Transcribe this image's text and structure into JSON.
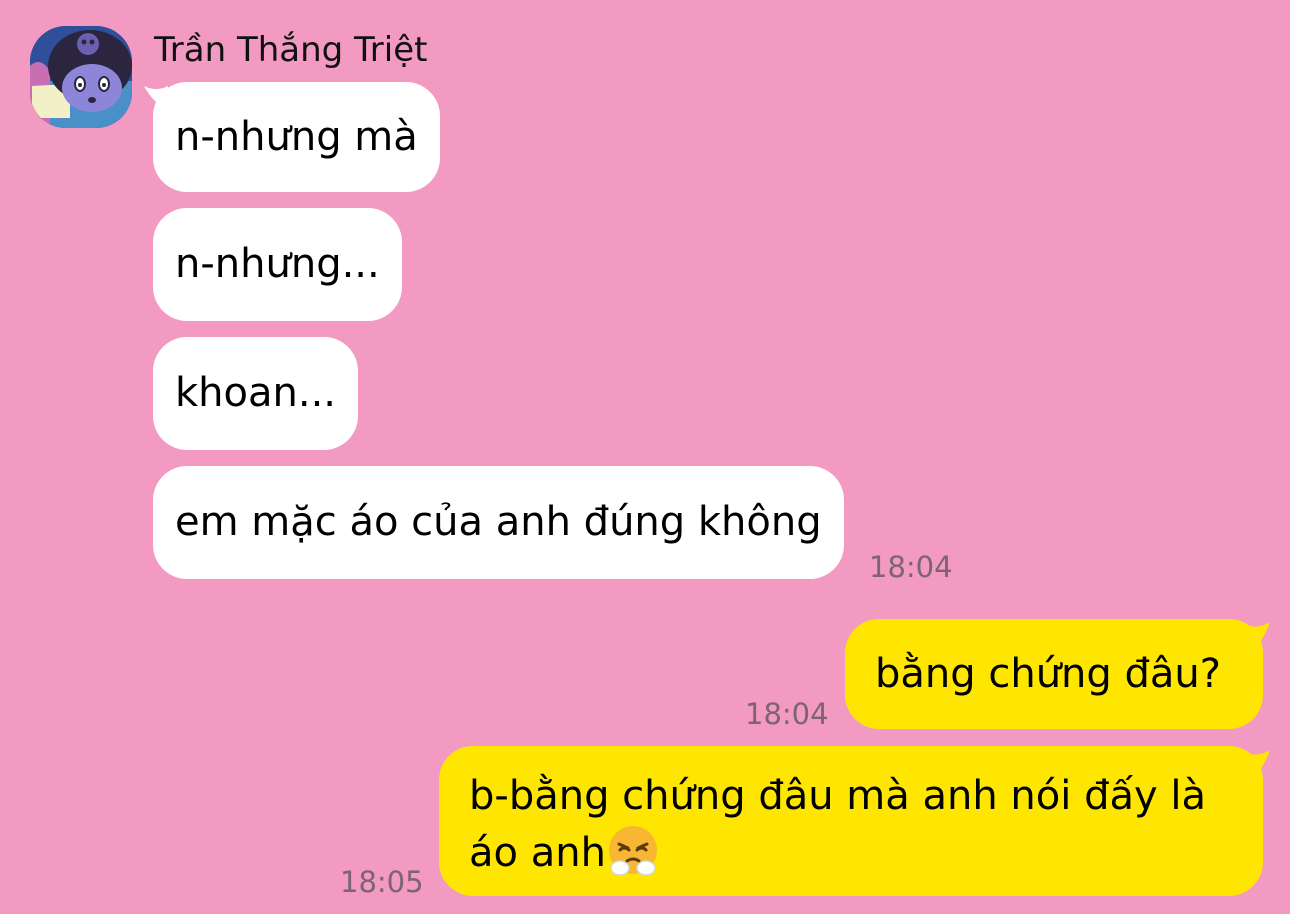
{
  "contact": {
    "name": "Trần Thắng Triệt",
    "avatar_icon": "kuromi-avatar-icon"
  },
  "colors": {
    "background": "#f29ac2",
    "incoming_bubble": "#ffffff",
    "outgoing_bubble": "#ffe600",
    "timestamp": "#7d6470"
  },
  "messages": [
    {
      "direction": "incoming",
      "text": "n-nhưng mà"
    },
    {
      "direction": "incoming",
      "text": "n-nhưng..."
    },
    {
      "direction": "incoming",
      "text": "khoan..."
    },
    {
      "direction": "incoming",
      "text": "em mặc áo của anh đúng không",
      "time": "18:04"
    },
    {
      "direction": "outgoing",
      "text": "bằng chứng đâu?",
      "time": "18:04"
    },
    {
      "direction": "outgoing",
      "text_line1": "b-bằng chứng đâu mà anh nói đấy là",
      "text_line2": "áo anh",
      "emoji": "face-with-steam-from-nose-icon",
      "time": "18:05"
    }
  ]
}
